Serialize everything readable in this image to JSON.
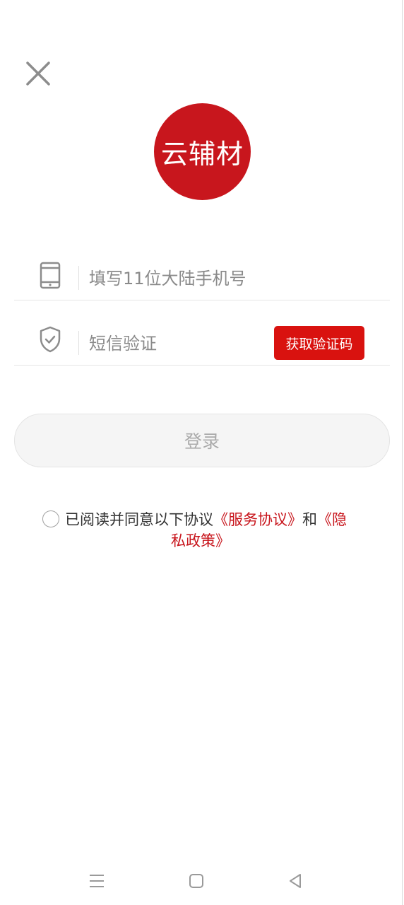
{
  "header": {
    "close_icon": "close-icon"
  },
  "logo": {
    "text": "云辅材",
    "color": "#c8161d"
  },
  "phone_field": {
    "icon": "phone-icon",
    "placeholder": "填写11位大陆手机号",
    "value": ""
  },
  "code_field": {
    "icon": "shield-check-icon",
    "placeholder": "短信验证",
    "value": "",
    "get_code_label": "获取验证码",
    "button_color": "#d9120f"
  },
  "login": {
    "label": "登录"
  },
  "agreement": {
    "checked": false,
    "text_prefix": "已阅读并同意以下协议",
    "service_link": "《服务协议》",
    "conjunction": "和",
    "privacy_link_part1": "《隐",
    "privacy_link_part2": "私政策》",
    "link_color": "#c8161d"
  },
  "navbar": {
    "menu_icon": "menu-icon",
    "home_icon": "home-square-icon",
    "back_icon": "back-triangle-icon"
  }
}
